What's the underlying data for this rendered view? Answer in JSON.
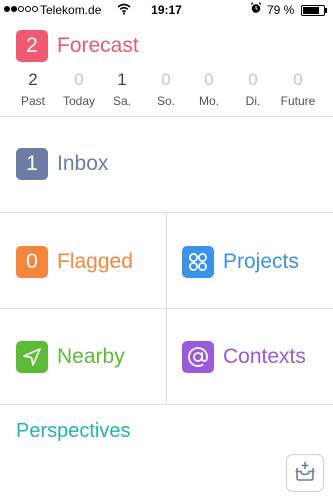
{
  "status_bar": {
    "carrier": "Telekom.de",
    "time": "19:17",
    "battery_pct": "79 %",
    "battery_level": 0.79,
    "signal_bars_filled": 2,
    "signal_bars_total": 5,
    "icons": [
      "wifi-icon",
      "alarm-icon",
      "battery-icon"
    ]
  },
  "forecast": {
    "badge": "2",
    "label": "Forecast",
    "color": "#ef5a70",
    "days": [
      {
        "count": "2",
        "name": "Past"
      },
      {
        "count": "0",
        "name": "Today"
      },
      {
        "count": "1",
        "name": "Sa."
      },
      {
        "count": "0",
        "name": "So."
      },
      {
        "count": "0",
        "name": "Mo."
      },
      {
        "count": "0",
        "name": "Di."
      },
      {
        "count": "0",
        "name": "Future"
      }
    ]
  },
  "inbox": {
    "badge": "1",
    "label": "Inbox",
    "color": "#6b7da3"
  },
  "flagged": {
    "badge": "0",
    "label": "Flagged",
    "color": "#f5863d"
  },
  "projects": {
    "label": "Projects",
    "icon": "projects-icon",
    "color": "#3b93e8"
  },
  "nearby": {
    "label": "Nearby",
    "icon": "location-arrow-icon",
    "color": "#5cbc38"
  },
  "contexts": {
    "label": "Contexts",
    "icon": "at-sign-icon",
    "color": "#9b5ad9"
  },
  "perspectives": {
    "label": "Perspectives",
    "color": "#22b3b0"
  },
  "quick_entry": {
    "icon": "inbox-add-icon"
  }
}
